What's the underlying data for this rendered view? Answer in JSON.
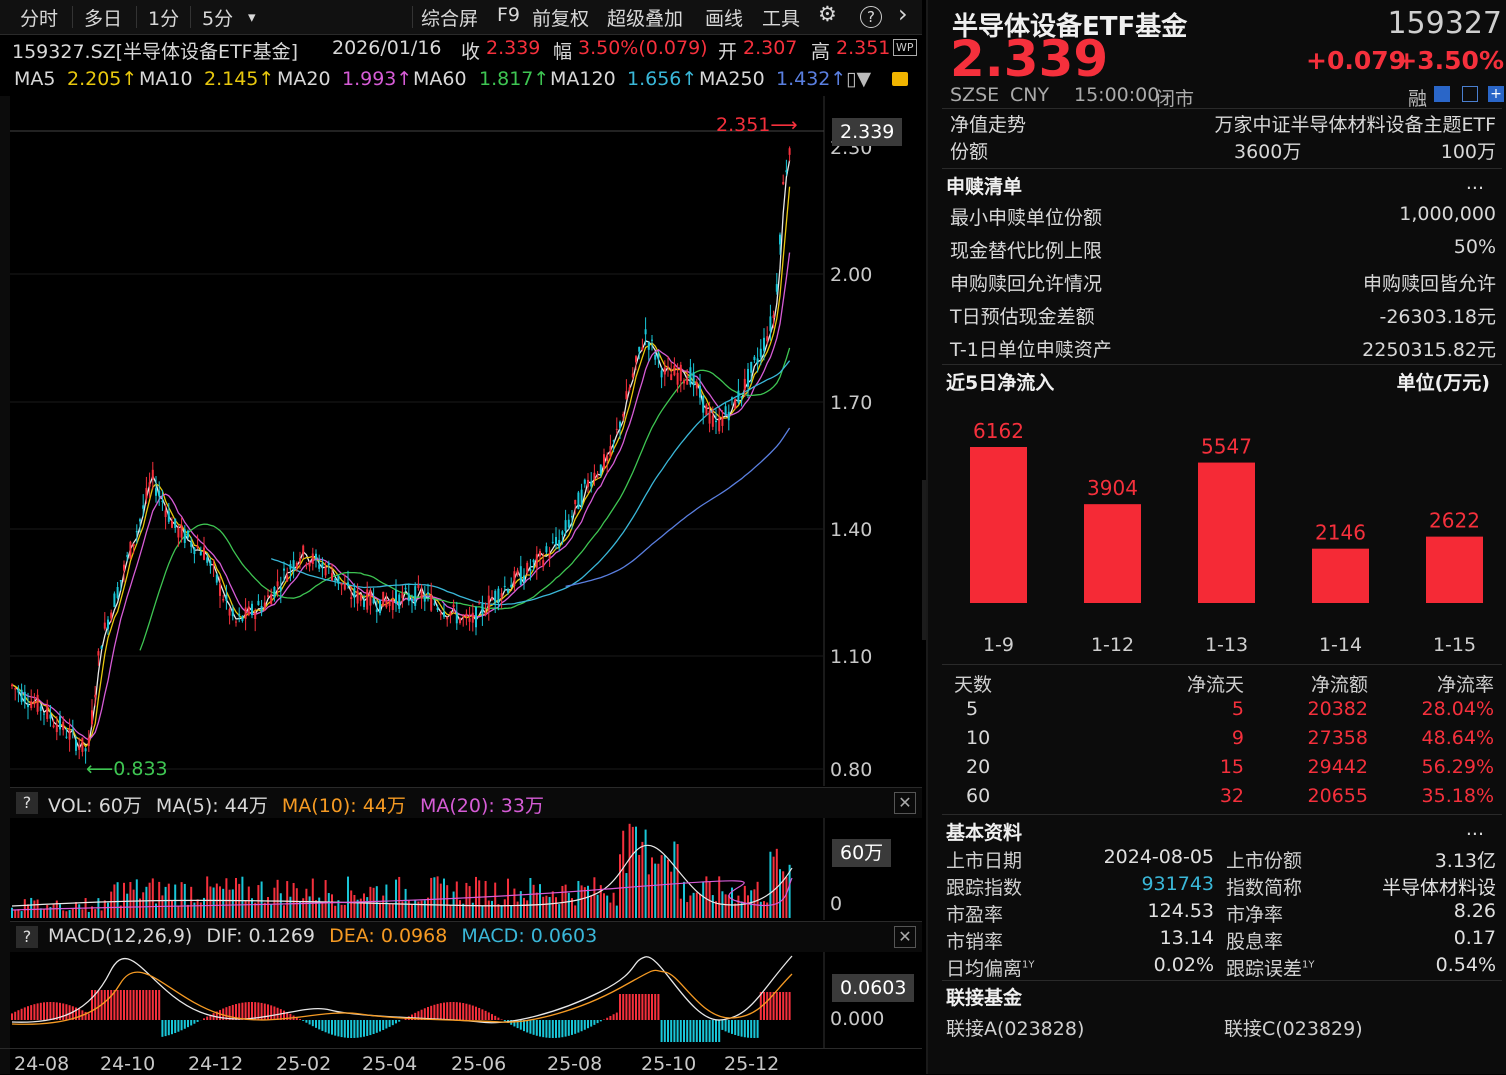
{
  "toolbar": {
    "tabs": [
      "分时",
      "多日",
      "1分",
      "5分"
    ],
    "dropdown_glyph": "▾",
    "menu": [
      "综合屏",
      "F9",
      "前复权",
      "超级叠加",
      "画线",
      "工具"
    ],
    "gear_glyph": "⚙",
    "help_glyph": "?",
    "next_glyph": "›"
  },
  "info": {
    "symbol": "159327.SZ[半导体设备ETF基金]",
    "date": "2026/01/16",
    "close_label": "收",
    "close": "2.339",
    "range_label": "幅",
    "range": "3.50%(0.079)",
    "open_label": "开",
    "open": "2.307",
    "high_label": "高",
    "high": "2.351",
    "wp_badge": "WP"
  },
  "ma": {
    "items": [
      {
        "label": "MA5",
        "value": "2.205↑",
        "color": "#e8c80e"
      },
      {
        "label": "MA10",
        "value": "2.145↑",
        "color": "#e8c80e"
      },
      {
        "label": "MA20",
        "value": "1.993↑",
        "color": "#d65cd6"
      },
      {
        "label": "MA60",
        "value": "1.817↑",
        "color": "#3ec552"
      },
      {
        "label": "MA120",
        "value": "1.656↑",
        "color": "#3ab7d8"
      },
      {
        "label": "MA250",
        "value": "1.432↑",
        "color": "#5a7fe0"
      }
    ],
    "more_glyph": "▯▼"
  },
  "price_axis": {
    "labels": [
      "2.30",
      "2.00",
      "1.70",
      "1.40",
      "1.10",
      "0.80"
    ],
    "current_tag": "2.339",
    "high_marker": "2.351⟶",
    "low_marker": "⟵0.833"
  },
  "volume": {
    "help": "?",
    "title": "VOL: 60万",
    "ma5": "MA(5): 44万",
    "ma10": "MA(10): 44万",
    "ma20": "MA(20): 33万",
    "tag": "60万",
    "zero": "0",
    "close_glyph": "✕"
  },
  "macd": {
    "help": "?",
    "title": "MACD(12,26,9)",
    "dif": "DIF: 0.1269",
    "dea": "DEA: 0.0968",
    "macd": "MACD: 0.0603",
    "tag": "0.0603",
    "zero": "0.000",
    "close_glyph": "✕"
  },
  "time_axis": [
    "24-08",
    "24-10",
    "24-12",
    "25-02",
    "25-04",
    "25-06",
    "25-08",
    "25-10",
    "25-12"
  ],
  "quote": {
    "name": "半导体设备ETF基金",
    "code": "159327",
    "price": "2.339",
    "change": "+0.079",
    "change_pct": "+3.50%",
    "market": "SZSE",
    "currency": "CNY",
    "time": "15:00:00",
    "status": "闭市",
    "rong": "融"
  },
  "fund_info": {
    "nav_label": "净值走势",
    "nav_value": "万家中证半导体材料设备主题ETF",
    "share_label": "份额",
    "share_value": "3600万",
    "share_value2": "100万"
  },
  "subscription": {
    "title": "申赎清单",
    "more": "...",
    "rows": [
      {
        "label": "最小申赎单位份额",
        "value": "1,000,000"
      },
      {
        "label": "现金替代比例上限",
        "value": "50%"
      },
      {
        "label": "申购赎回允许情况",
        "value": "申购赎回皆允许"
      },
      {
        "label": "T日预估现金差额",
        "value": "-26303.18元"
      },
      {
        "label": "T-1日单位申赎资产",
        "value": "2250315.82元"
      }
    ]
  },
  "inflow_title": "近5日净流入",
  "inflow_unit": "单位(万元)",
  "chart_data": {
    "type": "bar",
    "categories": [
      "1-9",
      "1-12",
      "1-13",
      "1-14",
      "1-15"
    ],
    "values": [
      6162,
      3904,
      5547,
      2146,
      2622
    ],
    "ylim": [
      0,
      6162
    ]
  },
  "flow_table": {
    "headers": [
      "天数",
      "净流天",
      "净流额",
      "净流率"
    ],
    "rows": [
      [
        "5",
        "5",
        "20382",
        "28.04%"
      ],
      [
        "10",
        "9",
        "27358",
        "48.64%"
      ],
      [
        "20",
        "15",
        "29442",
        "56.29%"
      ],
      [
        "60",
        "32",
        "20655",
        "35.18%"
      ]
    ]
  },
  "basic": {
    "title": "基本资料",
    "more": "...",
    "rows": [
      {
        "l1": "上市日期",
        "v1": "2024-08-05",
        "l2": "上市份额",
        "v2": "3.13亿"
      },
      {
        "l1": "跟踪指数",
        "v1": "931743",
        "l2": "指数简称",
        "v2": "半导体材料设"
      },
      {
        "l1": "市盈率",
        "v1": "124.53",
        "l2": "市净率",
        "v2": "8.26"
      },
      {
        "l1": "市销率",
        "v1": "13.14",
        "l2": "股息率",
        "v2": "0.17"
      },
      {
        "l1": "日均偏离",
        "sup1": "1Y",
        "v1": "0.02%",
        "l2": "跟踪误差",
        "sup2": "1Y",
        "v2": "0.54%"
      }
    ]
  },
  "linked": {
    "title": "联接基金",
    "a": "联接A(023828)",
    "c": "联接C(023829)"
  },
  "expander_glyph": "»"
}
